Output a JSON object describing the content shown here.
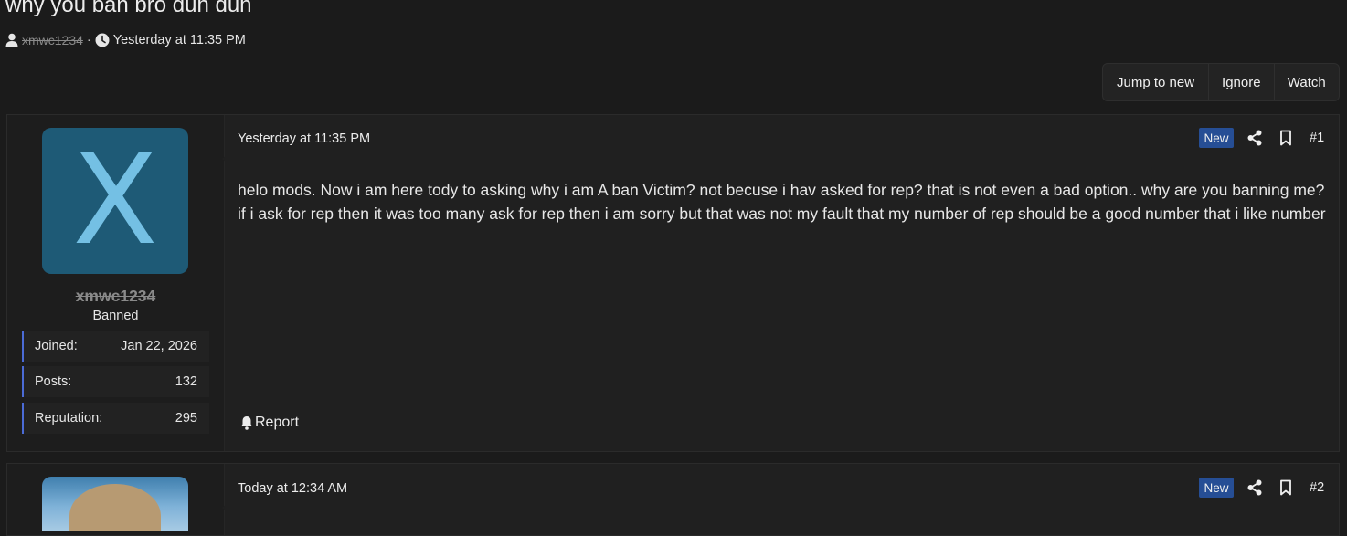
{
  "thread": {
    "title": "why you ban bro duh duh",
    "author": "xmwc1234",
    "separator": "·",
    "date": "Yesterday at 11:35 PM"
  },
  "actions": {
    "jump_to_new": "Jump to new",
    "ignore": "Ignore",
    "watch": "Watch"
  },
  "posts": [
    {
      "avatar_letter": "X",
      "username": "xmwc1234",
      "user_title": "Banned",
      "stats": [
        {
          "label": "Joined:",
          "value": "Jan 22, 2026"
        },
        {
          "label": "Posts:",
          "value": "132"
        },
        {
          "label": "Reputation:",
          "value": "295"
        }
      ],
      "date": "Yesterday at 11:35 PM",
      "badge": "New",
      "number": "#1",
      "body": [
        "helo mods. Now i am here tody to asking why i am A ban Victim? not becuse i hav asked for rep? that is not even a bad option.. why are you banning me?",
        "if i ask for rep then it was too many ask for rep then i am sorry but that was not my fault that my number of rep should be a good number that i like number"
      ],
      "report_label": "Report"
    },
    {
      "date": "Today at 12:34 AM",
      "badge": "New",
      "number": "#2"
    }
  ],
  "colors": {
    "background": "#1b1b1b",
    "post_background": "#202020",
    "avatar_background": "#1e5a76",
    "avatar_letter": "#74c0e4",
    "badge_new": "#264e95",
    "stat_accent": "#4b6bd6"
  },
  "icons": {
    "author": "user-icon",
    "date": "clock-icon",
    "share": "share-icon",
    "bookmark": "bookmark-icon",
    "report": "bell-icon"
  }
}
